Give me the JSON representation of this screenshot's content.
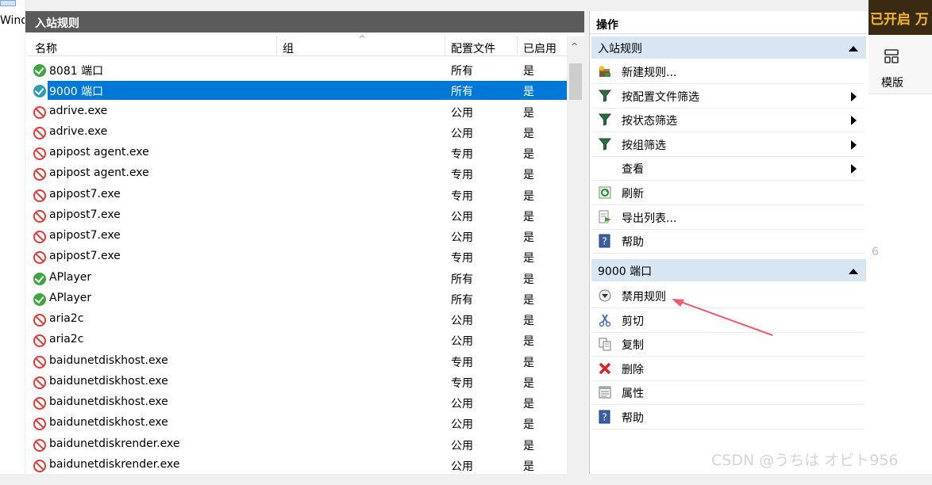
{
  "left_strip": {
    "text": "Wind"
  },
  "rules_panel": {
    "title": "入站规则",
    "columns": {
      "name": "名称",
      "group": "组",
      "profile": "配置文件",
      "enabled": "已启用"
    },
    "rows": [
      {
        "name": "8081 端口",
        "profile": "所有",
        "enabled": "是",
        "status": "allow",
        "selected": false
      },
      {
        "name": "9000 端口",
        "profile": "所有",
        "enabled": "是",
        "status": "allow",
        "selected": true
      },
      {
        "name": "adrive.exe",
        "profile": "公用",
        "enabled": "是",
        "status": "block",
        "selected": false
      },
      {
        "name": "adrive.exe",
        "profile": "公用",
        "enabled": "是",
        "status": "block",
        "selected": false
      },
      {
        "name": "apipost agent.exe",
        "profile": "专用",
        "enabled": "是",
        "status": "block",
        "selected": false
      },
      {
        "name": "apipost agent.exe",
        "profile": "专用",
        "enabled": "是",
        "status": "block",
        "selected": false
      },
      {
        "name": "apipost7.exe",
        "profile": "专用",
        "enabled": "是",
        "status": "block",
        "selected": false
      },
      {
        "name": "apipost7.exe",
        "profile": "公用",
        "enabled": "是",
        "status": "block",
        "selected": false
      },
      {
        "name": "apipost7.exe",
        "profile": "公用",
        "enabled": "是",
        "status": "block",
        "selected": false
      },
      {
        "name": "apipost7.exe",
        "profile": "专用",
        "enabled": "是",
        "status": "block",
        "selected": false
      },
      {
        "name": "APlayer",
        "profile": "所有",
        "enabled": "是",
        "status": "allow",
        "selected": false
      },
      {
        "name": "APlayer",
        "profile": "所有",
        "enabled": "是",
        "status": "allow",
        "selected": false
      },
      {
        "name": "aria2c",
        "profile": "公用",
        "enabled": "是",
        "status": "block",
        "selected": false
      },
      {
        "name": "aria2c",
        "profile": "公用",
        "enabled": "是",
        "status": "block",
        "selected": false
      },
      {
        "name": "baidunetdiskhost.exe",
        "profile": "专用",
        "enabled": "是",
        "status": "block",
        "selected": false
      },
      {
        "name": "baidunetdiskhost.exe",
        "profile": "专用",
        "enabled": "是",
        "status": "block",
        "selected": false
      },
      {
        "name": "baidunetdiskhost.exe",
        "profile": "公用",
        "enabled": "是",
        "status": "block",
        "selected": false
      },
      {
        "name": "baidunetdiskhost.exe",
        "profile": "公用",
        "enabled": "是",
        "status": "block",
        "selected": false
      },
      {
        "name": "baidunetdiskrender.exe",
        "profile": "公用",
        "enabled": "是",
        "status": "block",
        "selected": false
      },
      {
        "name": "baidunetdiskrender.exe",
        "profile": "公用",
        "enabled": "是",
        "status": "block",
        "selected": false
      }
    ]
  },
  "actions_pane": {
    "title": "操作",
    "section1": {
      "title": "入站规则",
      "items": [
        {
          "label": "新建规则...",
          "icon": "new-rule-icon",
          "submenu": false
        },
        {
          "label": "按配置文件筛选",
          "icon": "filter-icon",
          "submenu": true
        },
        {
          "label": "按状态筛选",
          "icon": "filter-icon",
          "submenu": true
        },
        {
          "label": "按组筛选",
          "icon": "filter-icon",
          "submenu": true
        },
        {
          "label": "查看",
          "icon": "",
          "submenu": true
        },
        {
          "label": "刷新",
          "icon": "refresh-icon",
          "submenu": false
        },
        {
          "label": "导出列表...",
          "icon": "export-icon",
          "submenu": false
        },
        {
          "label": "帮助",
          "icon": "help-icon",
          "submenu": false
        }
      ]
    },
    "section2": {
      "title": "9000 端口",
      "items": [
        {
          "label": "禁用规则",
          "icon": "disable-icon"
        },
        {
          "label": "剪切",
          "icon": "cut-icon"
        },
        {
          "label": "复制",
          "icon": "copy-icon"
        },
        {
          "label": "删除",
          "icon": "delete-icon"
        },
        {
          "label": "属性",
          "icon": "properties-icon"
        },
        {
          "label": "帮助",
          "icon": "help-icon"
        }
      ]
    }
  },
  "right_strip": {
    "banner_text": "已开启 万",
    "template_label": "模版",
    "partial_number": "6"
  },
  "watermark": "CSDN @うちは オビト956",
  "colors": {
    "selected_row": "#0078d7",
    "section_header": "#d7e6f2",
    "allow_icon": "#3fa63f",
    "block_icon": "#e53935",
    "annotation_arrow": "#f05a6e"
  }
}
